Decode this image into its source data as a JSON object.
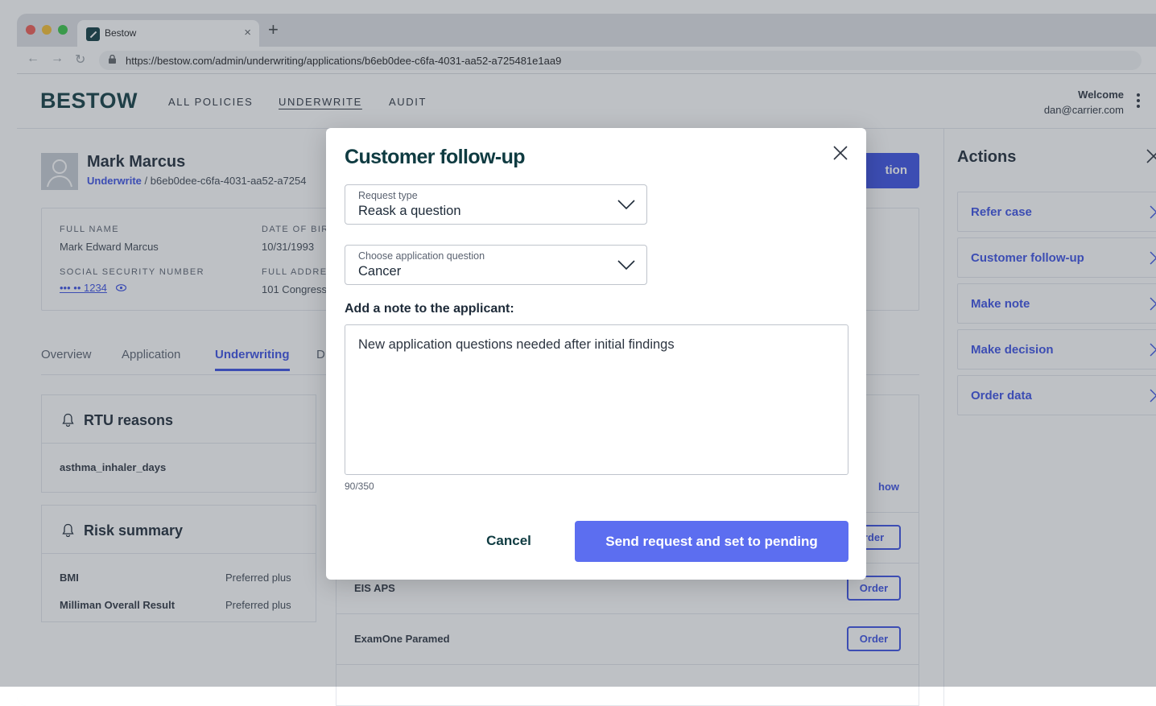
{
  "browser": {
    "tab_title": "Bestow",
    "tab_close": "×",
    "new_tab": "+",
    "url": "https://bestow.com/admin/underwriting/applications/b6eb0dee-c6fa-4031-aa52-a725481e1aa9"
  },
  "header": {
    "logo": "BESTOW",
    "nav": [
      "ALL POLICIES",
      "UNDERWRITE",
      "AUDIT"
    ],
    "welcome_label": "Welcome",
    "user_email": "dan@carrier.com"
  },
  "applicant": {
    "name": "Mark Marcus",
    "crumb_link": "Underwrite",
    "crumb_sep": " / ",
    "crumb_id": "b6eb0dee-c6fa-4031-aa52-a7254",
    "fields": {
      "full_name_label": "FULL NAME",
      "full_name": "Mark Edward Marcus",
      "dob_label": "DATE OF BIR",
      "dob": "10/31/1993",
      "ssn_label": "SOCIAL SECURITY NUMBER",
      "ssn": "••• •• 1234",
      "address_label": "FULL ADDRE",
      "address": "101 Congress"
    },
    "primary_button_partial": "tion"
  },
  "tabs": [
    "Overview",
    "Application",
    "Underwriting",
    "D"
  ],
  "rtu": {
    "title": "RTU reasons",
    "items": [
      "asthma_inhaler_days"
    ]
  },
  "risk": {
    "title": "Risk summary",
    "rows": [
      {
        "label": "BMI",
        "value": "Preferred plus"
      },
      {
        "label": "Milliman Overall Result",
        "value": "Preferred plus"
      }
    ]
  },
  "orders": {
    "show_partial": "how",
    "rows": [
      {
        "name": "",
        "button": "rder"
      },
      {
        "name": "EIS APS",
        "button": "Order"
      },
      {
        "name": "ExamOne Paramed",
        "button": "Order"
      }
    ]
  },
  "actions": {
    "title": "Actions",
    "items": [
      "Refer case",
      "Customer follow-up",
      "Make note",
      "Make decision",
      "Order data"
    ]
  },
  "modal": {
    "title": "Customer follow-up",
    "request_type_label": "Request type",
    "request_type_value": "Reask a question",
    "question_label": "Choose application question",
    "question_value": "Cancer",
    "note_label": "Add a note to the applicant:",
    "note_value": "New application questions needed after initial findings",
    "counter": "90/350",
    "cancel": "Cancel",
    "submit": "Send request and set to pending"
  },
  "colors": {
    "brand_dark": "#0f3b41",
    "accent": "#3b4fe4",
    "submit_button": "#5c6ef0"
  }
}
